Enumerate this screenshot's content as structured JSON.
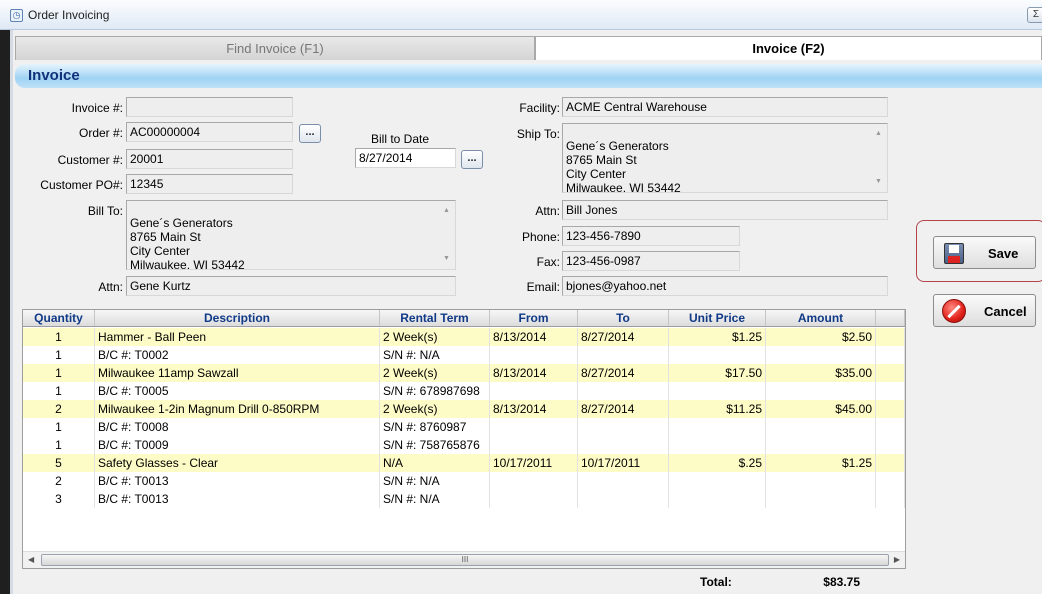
{
  "window": {
    "title": "Order Invoicing",
    "close_glyph": "Σ"
  },
  "tabs": [
    {
      "label": "Find Invoice (F1)",
      "active": false
    },
    {
      "label": "Invoice (F2)",
      "active": true
    }
  ],
  "section": {
    "title": "Invoice"
  },
  "form": {
    "invoice_no": {
      "label": "Invoice #:",
      "value": ""
    },
    "order_no": {
      "label": "Order #:",
      "value": "AC00000004",
      "button": "..."
    },
    "customer_no": {
      "label": "Customer #:",
      "value": "20001"
    },
    "customer_po": {
      "label": "Customer PO#:",
      "value": "12345"
    },
    "bill_to": {
      "label": "Bill To:",
      "value": "Gene´s Generators\n8765 Main St\nCity Center\nMilwaukee, WI  53442"
    },
    "bill_attn": {
      "label": "Attn:",
      "value": "Gene Kurtz"
    },
    "bill_to_date": {
      "label": "Bill to Date",
      "value": "8/27/2014",
      "button": "..."
    },
    "facility": {
      "label": "Facility:",
      "value": "ACME Central Warehouse"
    },
    "ship_to": {
      "label": "Ship To:",
      "value": "Gene´s Generators\n8765 Main St\nCity Center\nMilwaukee, WI  53442"
    },
    "ship_attn": {
      "label": "Attn:",
      "value": "Bill Jones"
    },
    "phone": {
      "label": "Phone:",
      "value": "123-456-7890"
    },
    "fax": {
      "label": "Fax:",
      "value": "123-456-0987"
    },
    "email": {
      "label": "Email:",
      "value": "bjones@yahoo.net"
    }
  },
  "grid": {
    "columns": [
      "Quantity",
      "Description",
      "Rental Term",
      "From",
      "To",
      "Unit Price",
      "Amount"
    ],
    "rows": [
      {
        "main": true,
        "cells": [
          "1",
          "Hammer - Ball Peen",
          "2 Week(s)",
          "8/13/2014",
          "8/27/2014",
          "$1.25",
          "$2.50"
        ]
      },
      {
        "main": false,
        "cells": [
          "1",
          "B/C #: T0002",
          "S/N #: N/A",
          "",
          "",
          "",
          ""
        ]
      },
      {
        "main": true,
        "cells": [
          "1",
          "Milwaukee 11amp Sawzall",
          "2 Week(s)",
          "8/13/2014",
          "8/27/2014",
          "$17.50",
          "$35.00"
        ]
      },
      {
        "main": false,
        "cells": [
          "1",
          "B/C #: T0005",
          "S/N #: 678987698",
          "",
          "",
          "",
          ""
        ]
      },
      {
        "main": true,
        "cells": [
          "2",
          "Milwaukee 1-2in Magnum Drill 0-850RPM",
          "2 Week(s)",
          "8/13/2014",
          "8/27/2014",
          "$11.25",
          "$45.00"
        ]
      },
      {
        "main": false,
        "cells": [
          "1",
          "B/C #: T0008",
          "S/N #: 8760987",
          "",
          "",
          "",
          ""
        ]
      },
      {
        "main": false,
        "cells": [
          "1",
          "B/C #: T0009",
          "S/N #: 758765876",
          "",
          "",
          "",
          ""
        ]
      },
      {
        "main": true,
        "cells": [
          "5",
          "Safety Glasses - Clear",
          "N/A",
          "10/17/2011",
          "10/17/2011",
          "$.25",
          "$1.25"
        ]
      },
      {
        "main": false,
        "cells": [
          "2",
          "B/C #: T0013",
          "S/N #: N/A",
          "",
          "",
          "",
          ""
        ]
      },
      {
        "main": false,
        "cells": [
          "3",
          "B/C #: T0013",
          "S/N #: N/A",
          "",
          "",
          "",
          ""
        ]
      }
    ],
    "scroll_thumb_glyph": "III"
  },
  "totals": {
    "label": "Total:",
    "value": "$83.75"
  },
  "actions": {
    "save": "Save",
    "cancel": "Cancel"
  },
  "colors": {
    "header_text": "#113a87",
    "main_row_bg": "#fdfbc6",
    "band_blue": "#9fd2f3",
    "save_highlight": "#b4444a"
  }
}
